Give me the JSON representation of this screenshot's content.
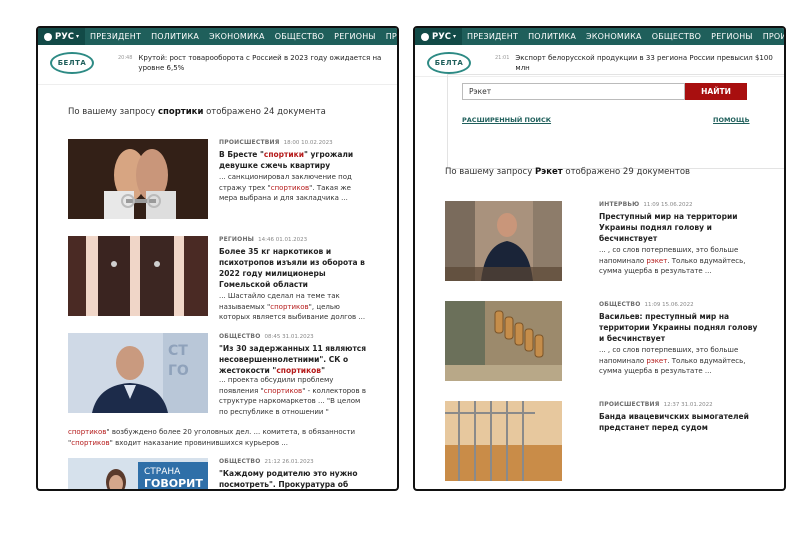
{
  "nav": {
    "lang": "РУС",
    "items": [
      "ПРЕЗИДЕНТ",
      "ПОЛИТИКА",
      "ЭКОНОМИКА",
      "ОБЩЕСТВО",
      "РЕГИОНЫ",
      "ПРОИСШЕСТВИЯ"
    ]
  },
  "logo_text": "БЕЛТА",
  "left": {
    "ticker_time": "20:48",
    "ticker_text": "Крутой: рост товарооборота с Россией в 2023 году ожидается на уровне 6,5%",
    "query_prefix": "По вашему запросу ",
    "query_term": "спортики",
    "query_suffix": " отображено 24 документа",
    "results": [
      {
        "category": "ПРОИСШЕСТВИЯ",
        "time": "18:00 10.02.2023",
        "title_parts": [
          "В Бресте \"",
          "спортики",
          "\" угрожали девушке сжечь квартиру"
        ],
        "snippet_parts": [
          "... санкционировал заключение под стражу трех \"",
          "спортиков",
          "\". Такая же мера выбрана и для закладчика ..."
        ]
      },
      {
        "category": "РЕГИОНЫ",
        "time": "14:46 01.01.2023",
        "title_parts": [
          "Более 35 кг наркотиков и психотропов изъяли из оборота в 2022 году милиционеры Гомельской области"
        ],
        "snippet_parts": [
          "... Шастайло сделал на теме так называемых \"",
          "спортиков",
          "\", целью которых является выбивание долгов ..."
        ]
      },
      {
        "category": "ОБЩЕСТВО",
        "time": "08:45 31.01.2023",
        "title_parts": [
          "\"Из 30 задержанных 11 являются несовершеннолетними\". СК о жестокости \"",
          "спортиков",
          "\""
        ],
        "snippet_parts": [
          "... проекта обсудили проблему появления \"",
          "спортиков",
          "\" - коллекторов в структуре наркомаркетов ... \"В целом по республике в отношении \"",
          "спортиков",
          "\" возбуждено более 20 уголовных дел. ... комитета, в обязанности \"",
          "спортиков",
          "\" входит наказание провинившихся курьеров ..."
        ]
      },
      {
        "category": "ОБЩЕСТВО",
        "time": "21:12 26.01.2023",
        "title_parts": [
          "\"Каждому родителю это нужно посмотреть\". Прокуратура об избиениях"
        ],
        "snippet_parts": [
          ""
        ]
      }
    ]
  },
  "right": {
    "ticker_time": "21:01",
    "ticker_text": "Экспорт белорусской продукции в 33 региона России превысил $100 млн",
    "search_value": "Рэкет",
    "search_button": "НАЙТИ",
    "advanced_search": "РАСШИРЕННЫЙ ПОИСК",
    "help": "ПОМОЩЬ",
    "query_prefix": "По вашему запросу ",
    "query_term": "Рэкет",
    "query_suffix": " отображено 29 документов",
    "results": [
      {
        "category": "ИНТЕРВЬЮ",
        "time": "11:09 15.06.2022",
        "title_parts": [
          "Преступный мир на территории Украины поднял голову и бесчинствует"
        ],
        "snippet_parts": [
          "... , со слов потерпевших, это больше напоминало ",
          "рэкет",
          ". Только вдумайтесь, сумма ущерба в результате ..."
        ]
      },
      {
        "category": "ОБЩЕСТВО",
        "time": "11:09 15.06.2022",
        "title_parts": [
          "Васильев: преступный мир на территории Украины поднял голову и бесчинствует"
        ],
        "snippet_parts": [
          "... , со слов потерпевших, это больше напоминало ",
          "рэкет",
          ". Только вдумайтесь, сумма ущерба в результате ..."
        ]
      },
      {
        "category": "ПРОИСШЕСТВИЯ",
        "time": "12:37 31.01.2022",
        "title_parts": [
          "Банда ивацевичских вымогателей предстанет перед судом"
        ],
        "snippet_parts": [
          ""
        ]
      }
    ]
  }
}
